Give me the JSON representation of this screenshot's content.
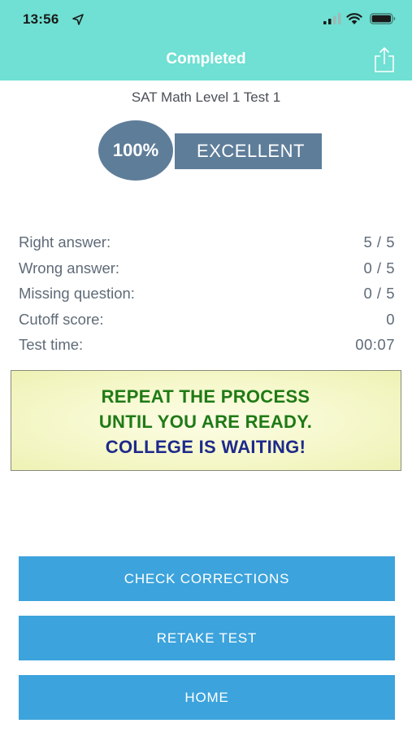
{
  "status_bar": {
    "time": "13:56",
    "location_icon": "location-arrow-icon",
    "signal_icon": "cellular-signal-icon",
    "wifi_icon": "wifi-icon",
    "battery_icon": "battery-icon"
  },
  "nav": {
    "title": "Completed",
    "share_icon": "share-icon",
    "background_color": "#6fe0d3"
  },
  "test": {
    "name": "SAT Math Level 1 Test 1"
  },
  "score": {
    "percent": "100%",
    "rating": "EXCELLENT",
    "color": "#5e7d99"
  },
  "stats": [
    {
      "label": "Right answer:",
      "value": "5 / 5"
    },
    {
      "label": "Wrong answer:",
      "value": "0 / 5"
    },
    {
      "label": "Missing question:",
      "value": "0 / 5"
    },
    {
      "label": "Cutoff score:",
      "value": "0"
    },
    {
      "label": "Test time:",
      "value": "00:07"
    }
  ],
  "motivation": {
    "line1": "REPEAT THE PROCESS",
    "line2": "UNTIL YOU ARE READY.",
    "line3": "COLLEGE IS WAITING!",
    "green_color": "#1f7a16",
    "blue_color": "#1e2a8a"
  },
  "buttons": {
    "check_corrections": "CHECK CORRECTIONS",
    "retake_test": "RETAKE TEST",
    "home": "HOME",
    "color": "#3ca3dc"
  }
}
